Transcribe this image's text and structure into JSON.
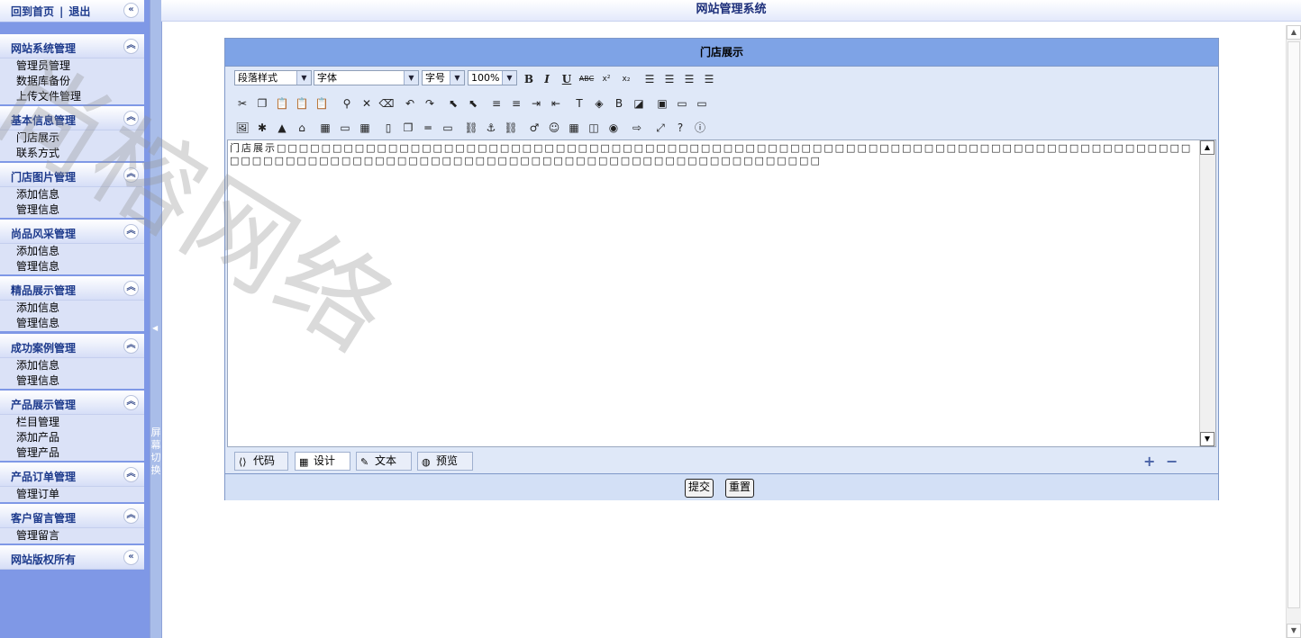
{
  "topbar": {
    "home": "回到首页",
    "sep": "|",
    "logout": "退出"
  },
  "sidebar": {
    "groups": [
      {
        "title": "网站系统管理",
        "items": [
          "管理员管理",
          "数据库备份",
          "上传文件管理"
        ]
      },
      {
        "title": "基本信息管理",
        "items": [
          "门店展示",
          "联系方式"
        ]
      },
      {
        "title": "门店图片管理",
        "items": [
          "添加信息",
          "管理信息"
        ]
      },
      {
        "title": "尚品风采管理",
        "items": [
          "添加信息",
          "管理信息"
        ]
      },
      {
        "title": "精品展示管理",
        "items": [
          "添加信息",
          "管理信息"
        ]
      },
      {
        "title": "成功案例管理",
        "items": [
          "添加信息",
          "管理信息"
        ]
      },
      {
        "title": "产品展示管理",
        "items": [
          "栏目管理",
          "添加产品",
          "管理产品"
        ]
      },
      {
        "title": "产品订单管理",
        "items": [
          "管理订单"
        ]
      },
      {
        "title": "客户留言管理",
        "items": [
          "管理留言"
        ]
      }
    ],
    "footer": "网站版权所有",
    "splitter_text": "屏幕切换"
  },
  "header": {
    "title": "网站管理系统"
  },
  "panel": {
    "title": "门店展示",
    "toolbar": {
      "paragraph_style": "段落样式",
      "font": "字体",
      "font_size": "字号",
      "zoom": "100%"
    },
    "content_prefix": "门店展示",
    "content_boxes": "□□□□□□□□□□□□□□□□□□□□□□□□□□□□□□□□□□□□□□□□□□□□□□□□□□□□□□□□□□□□□□□□□□□□□□□□□□□□□□□□□□□□□□□□□□□□□□□□□□□□□□□□□□□□□□□□□□□□□□□□□□□□□□□□□□□□□□□",
    "modes": {
      "code": "代码",
      "design": "设计",
      "text": "文本",
      "preview": "预览"
    },
    "submit": "提交",
    "reset": "重置"
  },
  "watermark": "尚榕网络"
}
